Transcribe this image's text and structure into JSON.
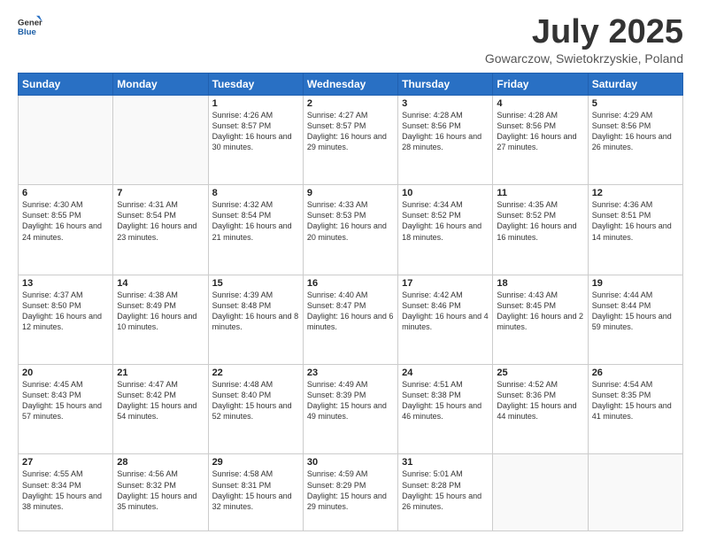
{
  "header": {
    "logo_general": "General",
    "logo_blue": "Blue",
    "month_title": "July 2025",
    "subtitle": "Gowarczow, Swietokrzyskie, Poland"
  },
  "days_of_week": [
    "Sunday",
    "Monday",
    "Tuesday",
    "Wednesday",
    "Thursday",
    "Friday",
    "Saturday"
  ],
  "weeks": [
    [
      {
        "day": "",
        "info": ""
      },
      {
        "day": "",
        "info": ""
      },
      {
        "day": "1",
        "info": "Sunrise: 4:26 AM\nSunset: 8:57 PM\nDaylight: 16 hours and 30 minutes."
      },
      {
        "day": "2",
        "info": "Sunrise: 4:27 AM\nSunset: 8:57 PM\nDaylight: 16 hours and 29 minutes."
      },
      {
        "day": "3",
        "info": "Sunrise: 4:28 AM\nSunset: 8:56 PM\nDaylight: 16 hours and 28 minutes."
      },
      {
        "day": "4",
        "info": "Sunrise: 4:28 AM\nSunset: 8:56 PM\nDaylight: 16 hours and 27 minutes."
      },
      {
        "day": "5",
        "info": "Sunrise: 4:29 AM\nSunset: 8:56 PM\nDaylight: 16 hours and 26 minutes."
      }
    ],
    [
      {
        "day": "6",
        "info": "Sunrise: 4:30 AM\nSunset: 8:55 PM\nDaylight: 16 hours and 24 minutes."
      },
      {
        "day": "7",
        "info": "Sunrise: 4:31 AM\nSunset: 8:54 PM\nDaylight: 16 hours and 23 minutes."
      },
      {
        "day": "8",
        "info": "Sunrise: 4:32 AM\nSunset: 8:54 PM\nDaylight: 16 hours and 21 minutes."
      },
      {
        "day": "9",
        "info": "Sunrise: 4:33 AM\nSunset: 8:53 PM\nDaylight: 16 hours and 20 minutes."
      },
      {
        "day": "10",
        "info": "Sunrise: 4:34 AM\nSunset: 8:52 PM\nDaylight: 16 hours and 18 minutes."
      },
      {
        "day": "11",
        "info": "Sunrise: 4:35 AM\nSunset: 8:52 PM\nDaylight: 16 hours and 16 minutes."
      },
      {
        "day": "12",
        "info": "Sunrise: 4:36 AM\nSunset: 8:51 PM\nDaylight: 16 hours and 14 minutes."
      }
    ],
    [
      {
        "day": "13",
        "info": "Sunrise: 4:37 AM\nSunset: 8:50 PM\nDaylight: 16 hours and 12 minutes."
      },
      {
        "day": "14",
        "info": "Sunrise: 4:38 AM\nSunset: 8:49 PM\nDaylight: 16 hours and 10 minutes."
      },
      {
        "day": "15",
        "info": "Sunrise: 4:39 AM\nSunset: 8:48 PM\nDaylight: 16 hours and 8 minutes."
      },
      {
        "day": "16",
        "info": "Sunrise: 4:40 AM\nSunset: 8:47 PM\nDaylight: 16 hours and 6 minutes."
      },
      {
        "day": "17",
        "info": "Sunrise: 4:42 AM\nSunset: 8:46 PM\nDaylight: 16 hours and 4 minutes."
      },
      {
        "day": "18",
        "info": "Sunrise: 4:43 AM\nSunset: 8:45 PM\nDaylight: 16 hours and 2 minutes."
      },
      {
        "day": "19",
        "info": "Sunrise: 4:44 AM\nSunset: 8:44 PM\nDaylight: 15 hours and 59 minutes."
      }
    ],
    [
      {
        "day": "20",
        "info": "Sunrise: 4:45 AM\nSunset: 8:43 PM\nDaylight: 15 hours and 57 minutes."
      },
      {
        "day": "21",
        "info": "Sunrise: 4:47 AM\nSunset: 8:42 PM\nDaylight: 15 hours and 54 minutes."
      },
      {
        "day": "22",
        "info": "Sunrise: 4:48 AM\nSunset: 8:40 PM\nDaylight: 15 hours and 52 minutes."
      },
      {
        "day": "23",
        "info": "Sunrise: 4:49 AM\nSunset: 8:39 PM\nDaylight: 15 hours and 49 minutes."
      },
      {
        "day": "24",
        "info": "Sunrise: 4:51 AM\nSunset: 8:38 PM\nDaylight: 15 hours and 46 minutes."
      },
      {
        "day": "25",
        "info": "Sunrise: 4:52 AM\nSunset: 8:36 PM\nDaylight: 15 hours and 44 minutes."
      },
      {
        "day": "26",
        "info": "Sunrise: 4:54 AM\nSunset: 8:35 PM\nDaylight: 15 hours and 41 minutes."
      }
    ],
    [
      {
        "day": "27",
        "info": "Sunrise: 4:55 AM\nSunset: 8:34 PM\nDaylight: 15 hours and 38 minutes."
      },
      {
        "day": "28",
        "info": "Sunrise: 4:56 AM\nSunset: 8:32 PM\nDaylight: 15 hours and 35 minutes."
      },
      {
        "day": "29",
        "info": "Sunrise: 4:58 AM\nSunset: 8:31 PM\nDaylight: 15 hours and 32 minutes."
      },
      {
        "day": "30",
        "info": "Sunrise: 4:59 AM\nSunset: 8:29 PM\nDaylight: 15 hours and 29 minutes."
      },
      {
        "day": "31",
        "info": "Sunrise: 5:01 AM\nSunset: 8:28 PM\nDaylight: 15 hours and 26 minutes."
      },
      {
        "day": "",
        "info": ""
      },
      {
        "day": "",
        "info": ""
      }
    ]
  ]
}
